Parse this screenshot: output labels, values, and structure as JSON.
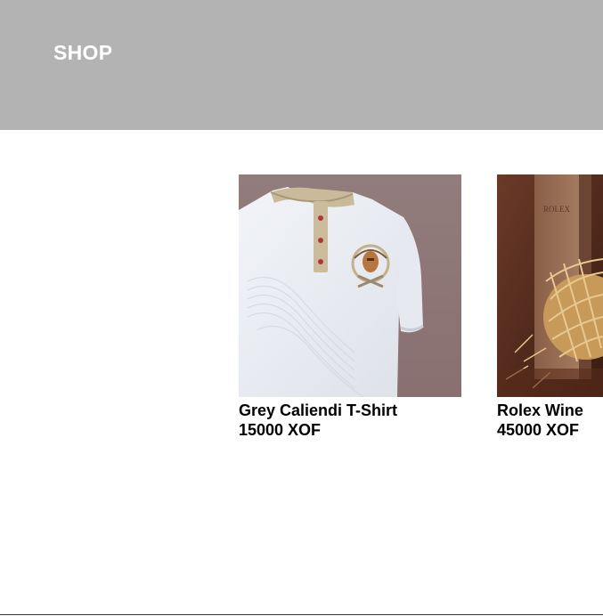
{
  "header": {
    "title": "SHOP"
  },
  "products": [
    {
      "name": "Grey Caliendi T-Shirt",
      "price": "15000 XOF",
      "image_icon": "tshirt-photo"
    },
    {
      "name": "Rolex Wine",
      "price": "45000 XOF",
      "image_icon": "wine-box-photo",
      "image_text": "ROLEX"
    }
  ],
  "colors": {
    "header_bg": "#b3b3b3",
    "header_text": "#ffffff",
    "text": "#000000"
  }
}
